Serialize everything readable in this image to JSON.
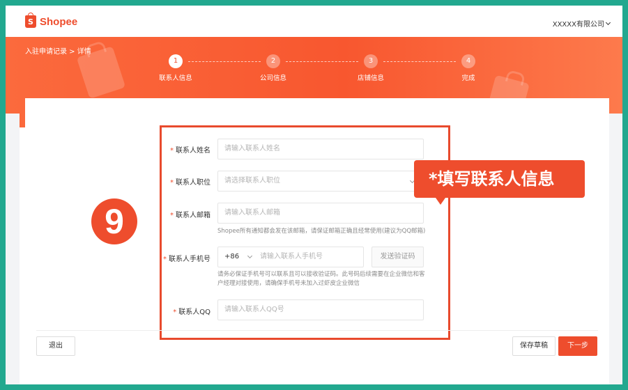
{
  "header": {
    "logo_text": "Shopee",
    "logo_glyph": "S",
    "company": "XXXXX有限公司"
  },
  "breadcrumb": "入驻申请记录 > 详情",
  "steps": [
    {
      "number": "1",
      "label": "联系人信息",
      "active": true
    },
    {
      "number": "2",
      "label": "公司信息",
      "active": false
    },
    {
      "number": "3",
      "label": "店铺信息",
      "active": false
    },
    {
      "number": "4",
      "label": "完成",
      "active": false
    }
  ],
  "form": {
    "name": {
      "label": "联系人姓名",
      "placeholder": "请输入联系人姓名"
    },
    "position": {
      "label": "联系人职位",
      "placeholder": "请选择联系人职位"
    },
    "email": {
      "label": "联系人邮箱",
      "placeholder": "请输入联系人邮箱",
      "hint": "Shopee所有通知都会发在该邮箱，请保证邮箱正确且经常使用(建议为QQ邮箱)"
    },
    "phone": {
      "label": "联系人手机号",
      "country_code": "+86",
      "placeholder": "请输入联系人手机号",
      "code_button": "发送验证码",
      "hint_line1": "请务必保证手机号可以联系且可以接收验证码。此号码后续需要在企业微信和客",
      "hint_line2": "户经理对接使用，请确保手机号未加入过虾皮企业微信"
    },
    "qq": {
      "label": "联系人QQ",
      "placeholder": "请输入联系人QQ号"
    },
    "required_mark": "*"
  },
  "annotation": {
    "badge": "9",
    "tooltip": "*填写联系人信息"
  },
  "footer": {
    "exit": "退出",
    "save_draft": "保存草稿",
    "next": "下一步"
  },
  "colors": {
    "brand": "#ee4d2d",
    "frame": "#22a88f"
  }
}
